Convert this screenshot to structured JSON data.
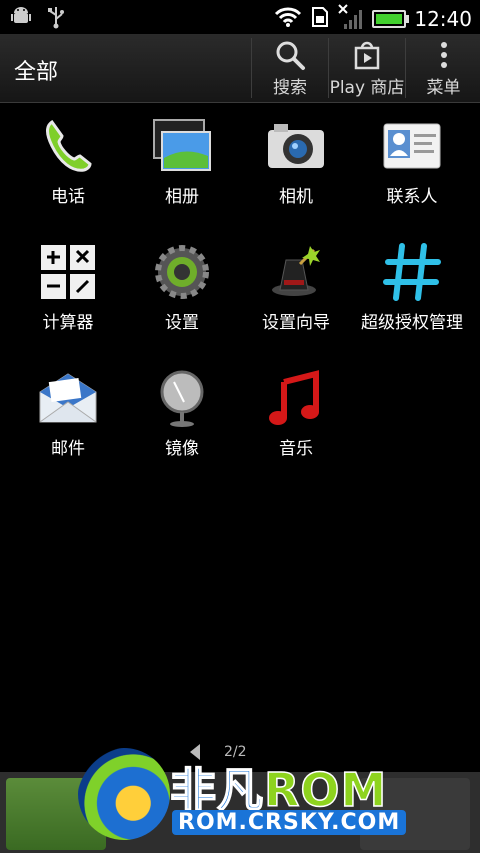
{
  "status_bar": {
    "time": "12:40",
    "icons": [
      "android-debug-icon",
      "usb-icon",
      "wifi-icon",
      "sd-card-icon",
      "no-signal-icon",
      "battery-icon"
    ],
    "battery_level": 1.0
  },
  "action_bar": {
    "title": "全部",
    "search_label": "搜索",
    "store_label": "Play 商店",
    "menu_label": "菜单"
  },
  "apps": [
    {
      "label": "电话",
      "icon": "phone-icon"
    },
    {
      "label": "相册",
      "icon": "gallery-icon"
    },
    {
      "label": "相机",
      "icon": "camera-icon"
    },
    {
      "label": "联系人",
      "icon": "contacts-icon"
    },
    {
      "label": "计算器",
      "icon": "calculator-icon"
    },
    {
      "label": "设置",
      "icon": "settings-gear-icon"
    },
    {
      "label": "设置向导",
      "icon": "setup-wizard-hat-icon"
    },
    {
      "label": "超级授权管理",
      "icon": "superuser-hash-icon"
    },
    {
      "label": "邮件",
      "icon": "mail-envelope-icon"
    },
    {
      "label": "镜像",
      "icon": "mirror-icon"
    },
    {
      "label": "音乐",
      "icon": "music-note-icon"
    }
  ],
  "pager": {
    "text": "2/2"
  },
  "watermark": {
    "title_a": "非凡",
    "title_b": "ROM",
    "url": "ROM.CRSKY.COM"
  },
  "colors": {
    "accent_green": "#42d02e",
    "brand_blue": "#1a74d8",
    "brand_green": "#8ed31e"
  }
}
